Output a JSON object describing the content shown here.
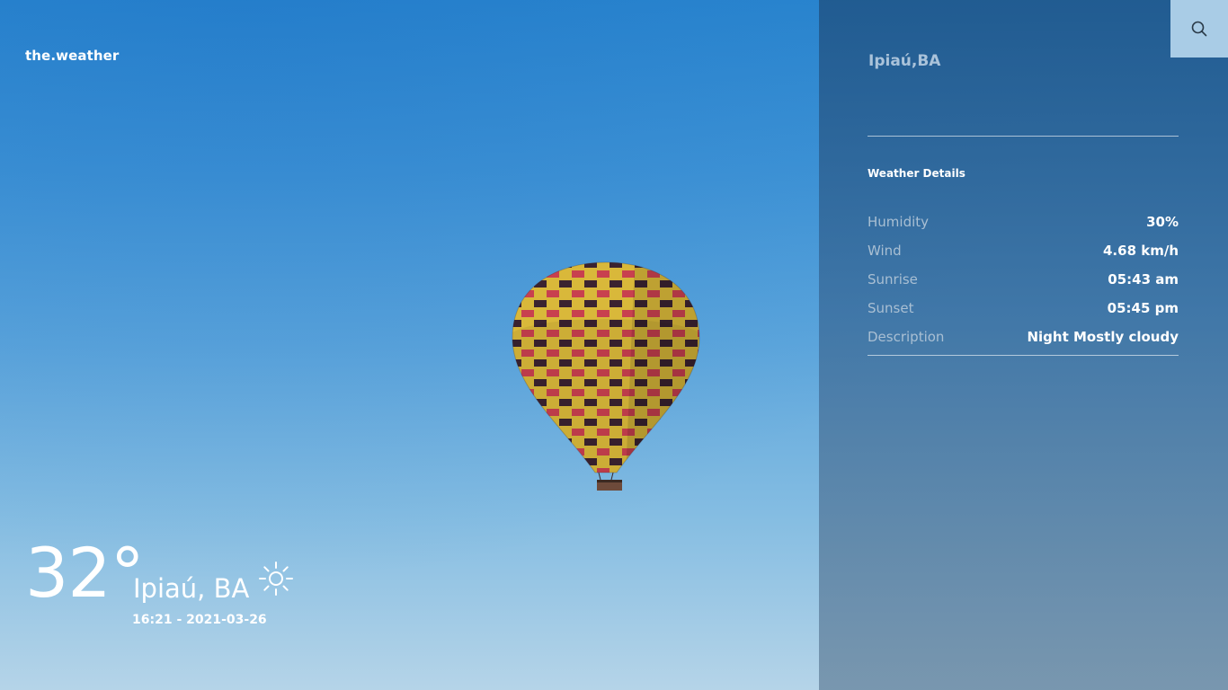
{
  "app": {
    "brand": "the.weather"
  },
  "current": {
    "temperature": "32°",
    "city": "Ipiaú, BA",
    "datetime": "16:21 - 2021-03-26",
    "condition_icon": "sun-icon"
  },
  "panel": {
    "search_icon": "search-icon",
    "location": "Ipiaú,BA",
    "details_title": "Weather Details",
    "details": [
      {
        "label": "Humidity",
        "value": "30%"
      },
      {
        "label": "Wind",
        "value": "4.68 km/h"
      },
      {
        "label": "Sunrise",
        "value": "05:43 am"
      },
      {
        "label": "Sunset",
        "value": "05:45 pm"
      },
      {
        "label": "Description",
        "value": "Night Mostly cloudy"
      }
    ]
  }
}
